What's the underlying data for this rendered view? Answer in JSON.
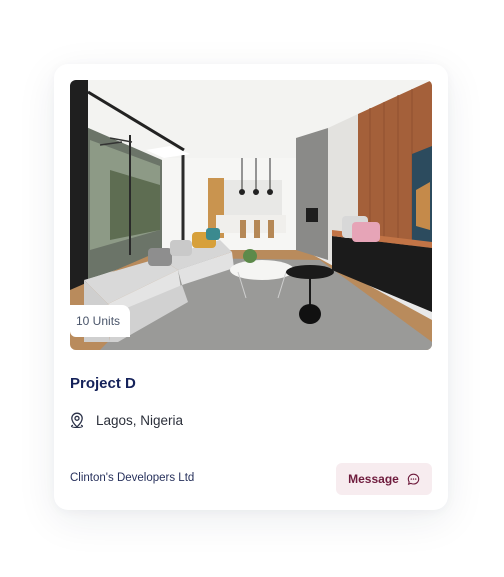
{
  "card": {
    "units_badge": "10 Units",
    "title": "Project D",
    "location": "Lagos, Nigeria",
    "developer": "Clinton's Developers Ltd",
    "message_label": "Message",
    "image_subject": "modern living room interior",
    "icons": {
      "location": "location-pin-icon",
      "message": "chat-bubble-icon"
    }
  },
  "colors": {
    "title": "#15225a",
    "button_background": "#f7ecef",
    "button_text": "#6f1c3d",
    "developer_text": "#27315c",
    "card_background": "#ffffff"
  }
}
